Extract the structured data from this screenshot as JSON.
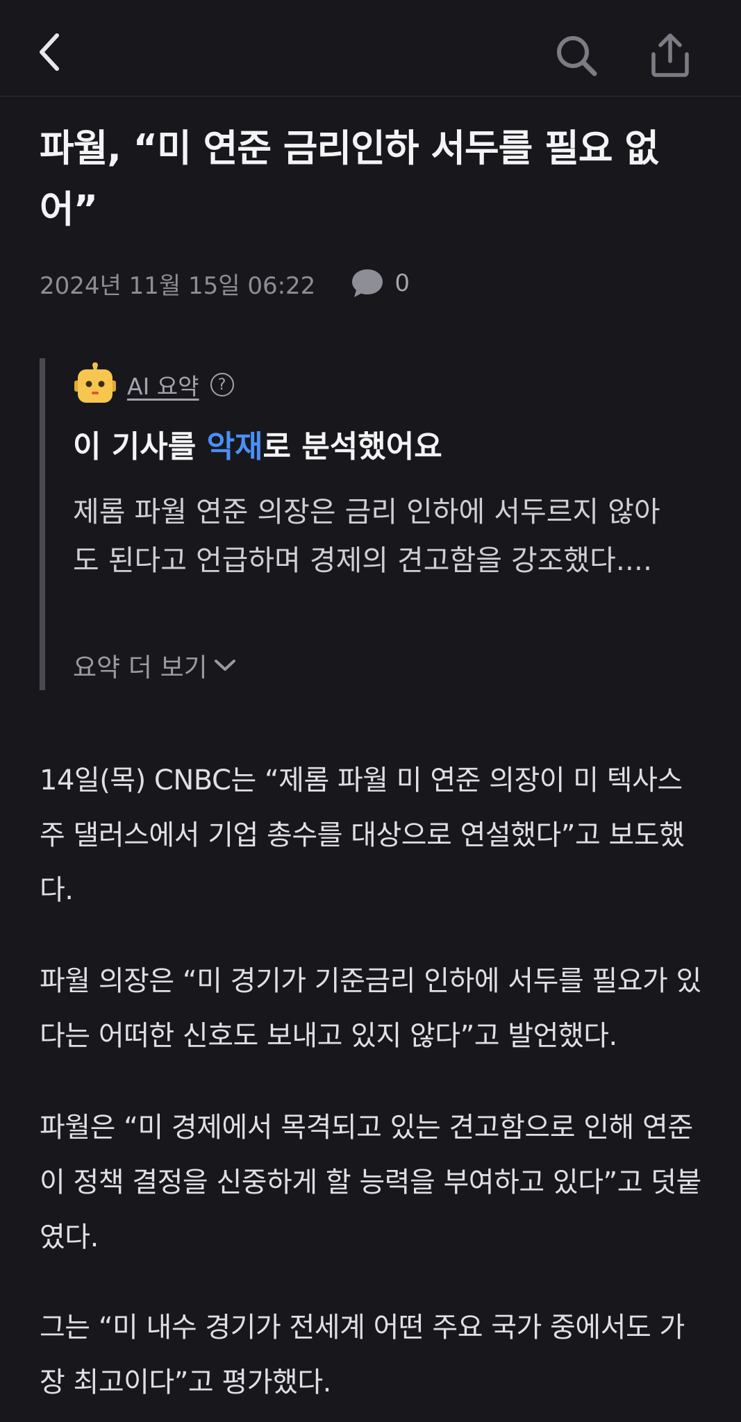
{
  "header": {
    "back_icon": "chevron-left-icon",
    "search_icon": "search-icon",
    "share_icon": "share-icon"
  },
  "article": {
    "title": "파월, “미 연준 금리인하 서두를 필요 없어”",
    "timestamp": "2024년 11월 15일 06:22",
    "comment_icon": "speech-bubble-icon",
    "comment_count": "0"
  },
  "ai_summary": {
    "icon": "robot-icon",
    "label": "AI 요약",
    "help": "?",
    "verdict_prefix": "이 기사를 ",
    "verdict_highlight": "악재",
    "verdict_suffix": "로 분석했어요",
    "highlight_color": "#4b8ff7",
    "text": "제롬 파월 연준 의장은 금리 인하에 서두르지 않아도 된다고 언급하며 경제의 견고함을 강조했다....",
    "more_label": "요약 더 보기"
  },
  "body": {
    "paragraphs": [
      "14일(목) CNBC는 “제롬 파월 미 연준 의장이 미 텍사스주 댈러스에서 기업 총수를 대상으로 연설했다”고 보도했다.",
      "파월 의장은 “미 경기가 기준금리 인하에 서두를 필요가 있다는 어떠한 신호도 보내고 있지 않다”고 발언했다.",
      "파월은 “미 경제에서 목격되고 있는 견고함으로 인해 연준이 정책 결정을 신중하게 할 능력을 부여하고 있다”고 덧붙였다.",
      "그는 “미 내수 경기가 전세계 어떤 주요 국가 중에서도 가장 최고이다”고 평가했다."
    ]
  },
  "colors": {
    "background": "#18181c",
    "accent": "#4b8ff7"
  }
}
